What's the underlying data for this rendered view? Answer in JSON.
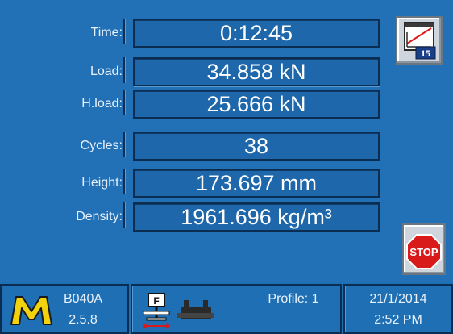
{
  "readouts": [
    {
      "label": "Time:",
      "value": "0:12:45"
    },
    {
      "label": "Load:",
      "value": "34.858 kN"
    },
    {
      "label": "H.load:",
      "value": "25.666 kN"
    },
    {
      "label": "Cycles:",
      "value": "38"
    },
    {
      "label": "Height:",
      "value": "173.697 mm"
    },
    {
      "label": "Density:",
      "value": "1961.696 kg/m³"
    }
  ],
  "chart_button": {
    "badge": "15"
  },
  "stop_button": {
    "label": "STOP"
  },
  "status_bar": {
    "firmware": {
      "line1": "B040A",
      "line2": "2.5.8"
    },
    "profile": "Profile: 1",
    "date": "21/1/2014",
    "time": "2:52 PM"
  },
  "colors": {
    "background": "#2270b6",
    "logo_yellow": "#f2d20a",
    "stop_red": "#d81a1a"
  }
}
